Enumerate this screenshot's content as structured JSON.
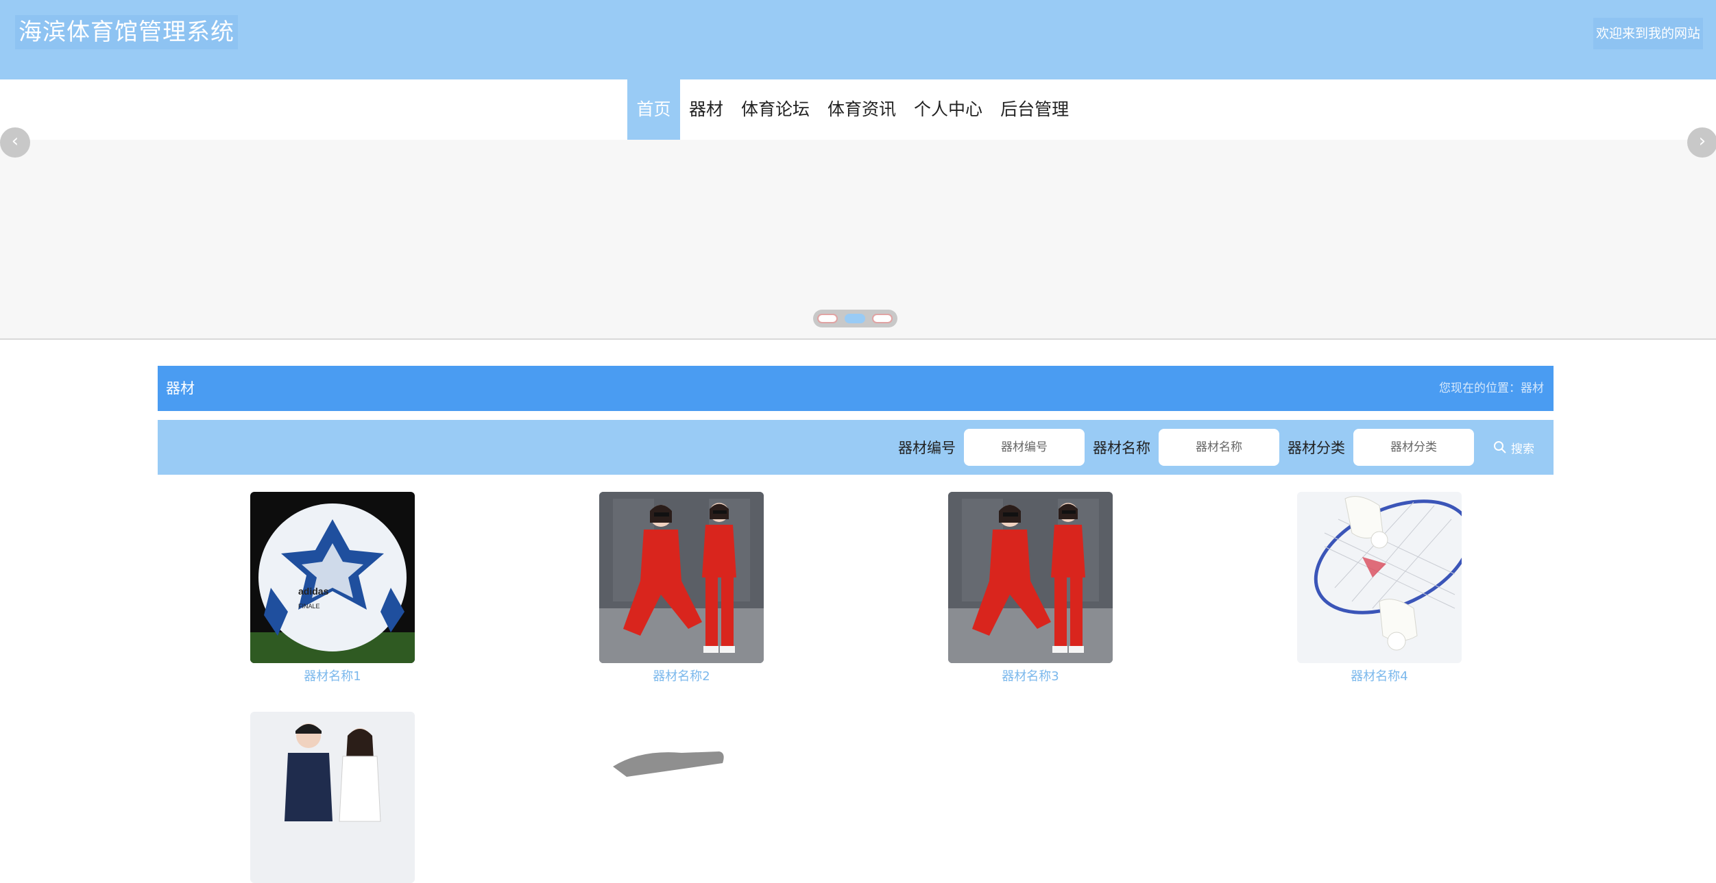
{
  "header": {
    "site_title": "海滨体育馆管理系统",
    "welcome_text": "欢迎来到我的网站"
  },
  "nav": {
    "items": [
      {
        "label": "首页",
        "active": true
      },
      {
        "label": "器材"
      },
      {
        "label": "体育论坛"
      },
      {
        "label": "体育资讯"
      },
      {
        "label": "个人中心"
      },
      {
        "label": "后台管理"
      }
    ]
  },
  "carousel": {
    "prev_glyph": "‹",
    "next_glyph": "›",
    "slide_count": 3,
    "active_index": 1
  },
  "section": {
    "title": "器材",
    "breadcrumb": "您现在的位置：器材"
  },
  "search": {
    "fields": [
      {
        "label": "器材编号",
        "placeholder": "器材编号"
      },
      {
        "label": "器材名称",
        "placeholder": "器材名称"
      },
      {
        "label": "器材分类",
        "placeholder": "器材分类"
      }
    ],
    "button_label": "搜索",
    "button_icon": "search-icon"
  },
  "products": [
    {
      "name": "器材名称1",
      "image": "soccer-ball-image"
    },
    {
      "name": "器材名称2",
      "image": "red-tracksuit-image"
    },
    {
      "name": "器材名称3",
      "image": "red-tracksuit-image"
    },
    {
      "name": "器材名称4",
      "image": "badminton-image"
    },
    {
      "name": "",
      "image": "couple-sportswear-image"
    },
    {
      "name": "",
      "image": "shoe-image"
    }
  ],
  "colors": {
    "header_bg": "#99cbf5",
    "section_bar": "#4a9cf2",
    "product_link": "#7bb8ec"
  }
}
